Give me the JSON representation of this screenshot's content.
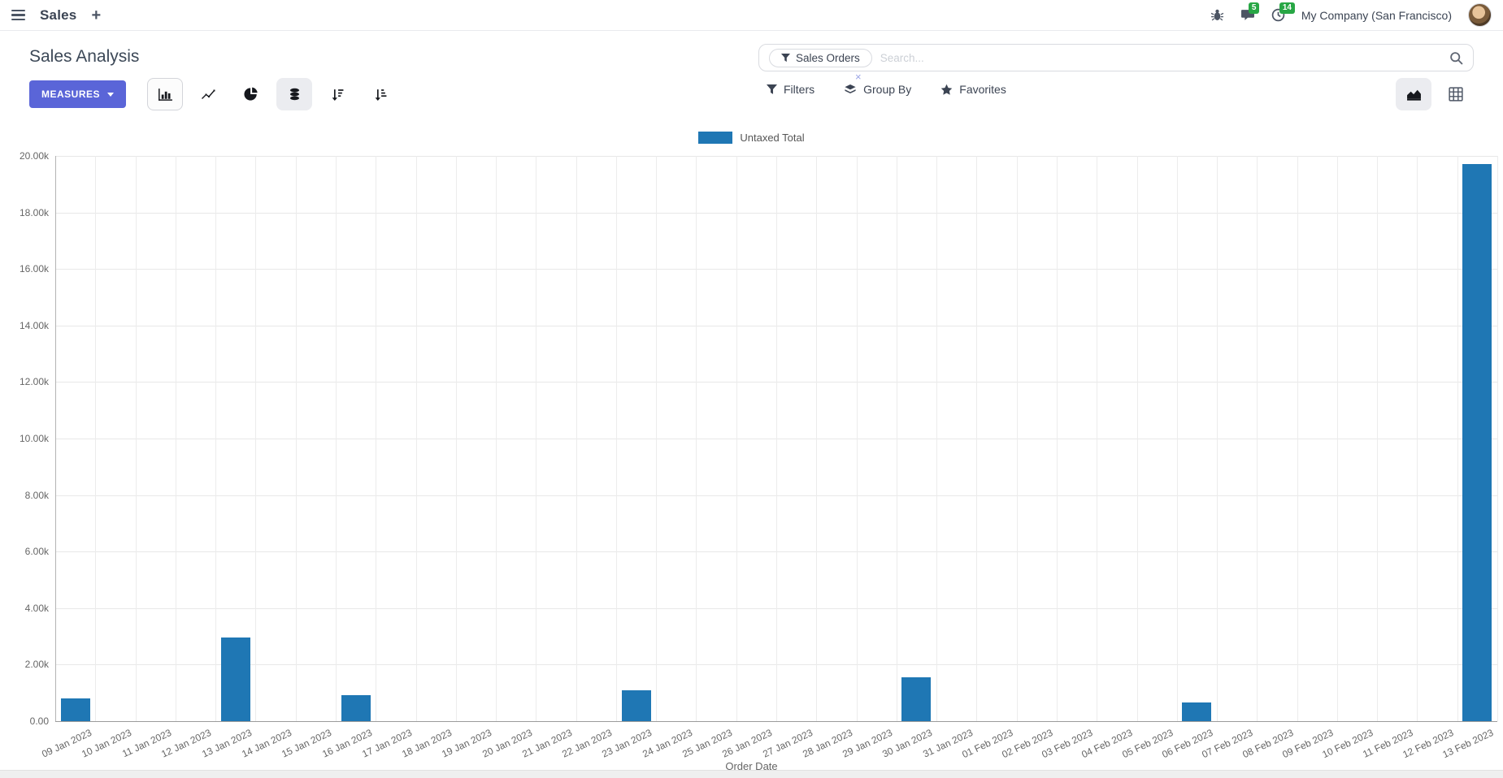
{
  "navbar": {
    "app_menu_label": "Sales",
    "new_tab_label": "+",
    "messages_badge": "5",
    "activities_badge": "14",
    "company": "My Company (San Francisco)"
  },
  "control_panel": {
    "title": "Sales Analysis",
    "measures_label": "MEASURES",
    "search": {
      "facet_label": "Sales Orders",
      "facet_remove": "×",
      "placeholder": "Search..."
    },
    "filters_label": "Filters",
    "group_by_label": "Group By",
    "favorites_label": "Favorites"
  },
  "icons": [
    "menu-icon",
    "plus-icon",
    "bug-icon",
    "messages-icon",
    "clock-icon",
    "avatar",
    "filter-facet-icon",
    "search-icon",
    "caret-down-icon",
    "bar-chart-icon",
    "line-chart-icon",
    "pie-chart-icon",
    "stacked-icon",
    "sort-desc-icon",
    "sort-asc-icon",
    "filter-icon",
    "layers-icon",
    "star-icon",
    "area-chart-icon",
    "pivot-icon"
  ],
  "colors": {
    "accent_button": "#5a65d8",
    "bar_color": "#1f77b4",
    "badge_green": "#28a745"
  },
  "chart_data": {
    "type": "bar",
    "title": "",
    "legend": [
      "Untaxed Total"
    ],
    "xlabel": "Order Date",
    "ylabel": "",
    "ylim": [
      0,
      20000
    ],
    "ytick_step": 2000,
    "ytick_labels": [
      "0.00",
      "2.00k",
      "4.00k",
      "6.00k",
      "8.00k",
      "10.00k",
      "12.00k",
      "14.00k",
      "16.00k",
      "18.00k",
      "20.00k"
    ],
    "grid": true,
    "legend_position": "top-center",
    "bar_color": "#1f77b4",
    "categories": [
      "09 Jan 2023",
      "10 Jan 2023",
      "11 Jan 2023",
      "12 Jan 2023",
      "13 Jan 2023",
      "14 Jan 2023",
      "15 Jan 2023",
      "16 Jan 2023",
      "17 Jan 2023",
      "18 Jan 2023",
      "19 Jan 2023",
      "20 Jan 2023",
      "21 Jan 2023",
      "22 Jan 2023",
      "23 Jan 2023",
      "24 Jan 2023",
      "25 Jan 2023",
      "26 Jan 2023",
      "27 Jan 2023",
      "28 Jan 2023",
      "29 Jan 2023",
      "30 Jan 2023",
      "31 Jan 2023",
      "01 Feb 2023",
      "02 Feb 2023",
      "03 Feb 2023",
      "04 Feb 2023",
      "05 Feb 2023",
      "06 Feb 2023",
      "07 Feb 2023",
      "08 Feb 2023",
      "09 Feb 2023",
      "10 Feb 2023",
      "11 Feb 2023",
      "12 Feb 2023",
      "13 Feb 2023"
    ],
    "values": [
      800,
      0,
      0,
      0,
      2950,
      0,
      0,
      920,
      0,
      0,
      0,
      0,
      0,
      0,
      1090,
      0,
      0,
      0,
      0,
      0,
      0,
      1550,
      0,
      0,
      0,
      0,
      0,
      0,
      660,
      0,
      0,
      0,
      0,
      0,
      0,
      19700
    ]
  }
}
